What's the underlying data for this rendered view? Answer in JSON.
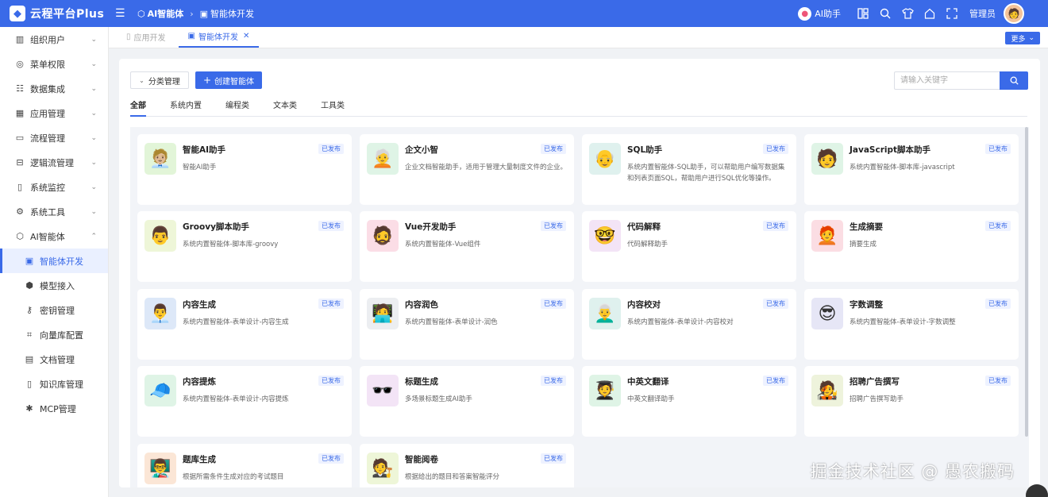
{
  "header": {
    "logo_text": "云程平台Plus",
    "breadcrumb": [
      {
        "label": "AI智能体",
        "icon": "cube-icon"
      },
      {
        "label": "智能体开发",
        "icon": "image-icon"
      }
    ],
    "ai_helper": "AI助手",
    "admin": "管理员",
    "color": "#3a6ae8"
  },
  "sidebar": {
    "items": [
      {
        "label": "组织用户",
        "icon": "building-icon",
        "expandable": true
      },
      {
        "label": "菜单权限",
        "icon": "compass-icon",
        "expandable": true
      },
      {
        "label": "数据集成",
        "icon": "database-icon",
        "expandable": true
      },
      {
        "label": "应用管理",
        "icon": "grid-icon",
        "expandable": true
      },
      {
        "label": "流程管理",
        "icon": "flow-icon",
        "expandable": true
      },
      {
        "label": "逻辑流管理",
        "icon": "logic-icon",
        "expandable": true
      },
      {
        "label": "系统监控",
        "icon": "monitor-icon",
        "expandable": true
      },
      {
        "label": "系统工具",
        "icon": "gear-icon",
        "expandable": true
      },
      {
        "label": "AI智能体",
        "icon": "cube-icon",
        "expanded": true
      },
      {
        "label": "智能体开发",
        "icon": "image-icon",
        "sub": true,
        "active": true
      },
      {
        "label": "模型接入",
        "icon": "box-icon",
        "sub": true
      },
      {
        "label": "密钥管理",
        "icon": "key-icon",
        "sub": true
      },
      {
        "label": "向量库配置",
        "icon": "crop-icon",
        "sub": true
      },
      {
        "label": "文档管理",
        "icon": "file-icon",
        "sub": true
      },
      {
        "label": "知识库管理",
        "icon": "book-icon",
        "sub": true
      },
      {
        "label": "MCP管理",
        "icon": "settings-icon",
        "sub": true
      }
    ]
  },
  "page_tabs": [
    {
      "label": "应用开发",
      "active": false
    },
    {
      "label": "智能体开发",
      "active": true
    }
  ],
  "more_label": "更多",
  "toolbar": {
    "category_label": "分类管理",
    "create_label": "创建智能体",
    "search_placeholder": "请输入关键字"
  },
  "category_tabs": [
    "全部",
    "系统内置",
    "编程类",
    "文本类",
    "工具类"
  ],
  "cards": [
    {
      "title": "智能AI助手",
      "badge": "已发布",
      "desc": "智能AI助手",
      "bg": "#e2f5d8",
      "emoji": "🧑🏼‍💼"
    },
    {
      "title": "企文小智",
      "badge": "已发布",
      "desc": "企业文档智能助手，适用于管理大量制度文件的企业。",
      "bg": "#dff4e6",
      "emoji": "🧑‍🦳"
    },
    {
      "title": "SQL助手",
      "badge": "已发布",
      "desc": "系统内置智能体-SQL助手，可以帮助用户编写数据集和列表页面SQL，帮助用户进行SQL优化等操作。",
      "bg": "#dff1ee",
      "emoji": "👴"
    },
    {
      "title": "JavaScript脚本助手",
      "badge": "已发布",
      "desc": "系统内置智能体-脚本库-javascript",
      "bg": "#dff4e6",
      "emoji": "🧑"
    },
    {
      "title": "Groovy脚本助手",
      "badge": "已发布",
      "desc": "系统内置智能体-脚本库-groovy",
      "bg": "#eef6d8",
      "emoji": "👨"
    },
    {
      "title": "Vue开发助手",
      "badge": "已发布",
      "desc": "系统内置智能体-Vue组件",
      "bg": "#fbdde6",
      "emoji": "🧔"
    },
    {
      "title": "代码解释",
      "badge": "已发布",
      "desc": "代码解释助手",
      "bg": "#f3e4f6",
      "emoji": "🤓"
    },
    {
      "title": "生成摘要",
      "badge": "已发布",
      "desc": "摘要生成",
      "bg": "#fbdde3",
      "emoji": "🧑‍🦰"
    },
    {
      "title": "内容生成",
      "badge": "已发布",
      "desc": "系统内置智能体-表单设计-内容生成",
      "bg": "#dde8f8",
      "emoji": "👨‍💼"
    },
    {
      "title": "内容润色",
      "badge": "已发布",
      "desc": "系统内置智能体-表单设计-润色",
      "bg": "#eceef1",
      "emoji": "🧑‍💻"
    },
    {
      "title": "内容校对",
      "badge": "已发布",
      "desc": "系统内置智能体-表单设计-内容校对",
      "bg": "#dff1ee",
      "emoji": "👨‍🦳"
    },
    {
      "title": "字数调整",
      "badge": "已发布",
      "desc": "系统内置智能体-表单设计-字数调整",
      "bg": "#e6e6f6",
      "emoji": "😎"
    },
    {
      "title": "内容提炼",
      "badge": "已发布",
      "desc": "系统内置智能体-表单设计-内容提炼",
      "bg": "#dff4e6",
      "emoji": "🧢"
    },
    {
      "title": "标题生成",
      "badge": "已发布",
      "desc": "多场景标题生成AI助手",
      "bg": "#f3e4f6",
      "emoji": "🕶️"
    },
    {
      "title": "中英文翻译",
      "badge": "已发布",
      "desc": "中英文翻译助手",
      "bg": "#dff4e6",
      "emoji": "🧑‍🎓"
    },
    {
      "title": "招聘广告撰写",
      "badge": "已发布",
      "desc": "招聘广告撰写助手",
      "bg": "#eef3dc",
      "emoji": "🧑‍🎤"
    },
    {
      "title": "题库生成",
      "badge": "已发布",
      "desc": "根据所需条件生成对应的考试题目",
      "bg": "#fbe6d6",
      "emoji": "👨‍🏫"
    },
    {
      "title": "智能阅卷",
      "badge": "已发布",
      "desc": "根据给出的题目和答案智能评分",
      "bg": "#eef6d8",
      "emoji": "🧑‍⚖️"
    }
  ],
  "watermark": "掘金技术社区 @ 愚农搬码"
}
